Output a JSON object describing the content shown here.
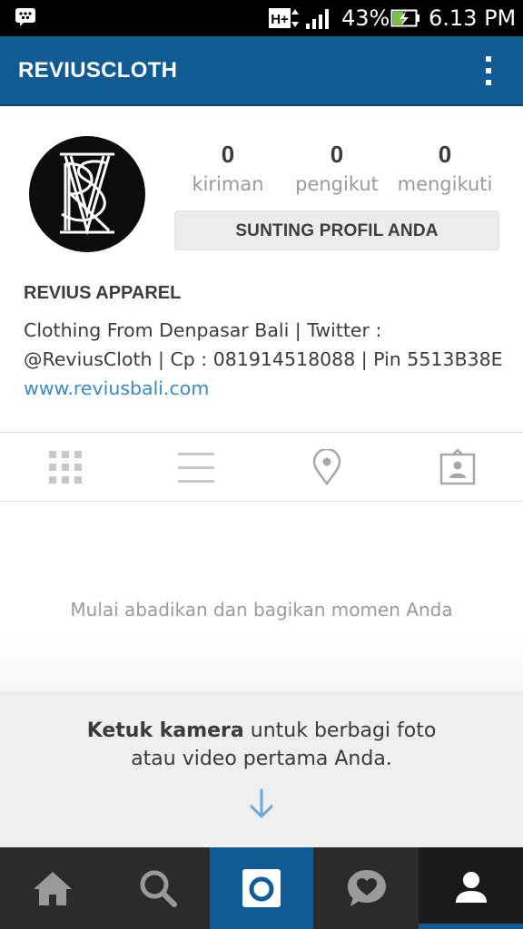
{
  "status_bar": {
    "network": "H+",
    "battery_percent": "43%",
    "time": "6.13 PM",
    "icons": [
      "bbm-icon",
      "hplus-data-icon",
      "signal-icon",
      "battery-charging-icon"
    ]
  },
  "action_bar": {
    "title": "REVIUSCLOTH",
    "menu_icon": "overflow-menu-icon"
  },
  "profile": {
    "avatar_icon": "revius-monogram-logo",
    "stats": [
      {
        "count": "0",
        "label": "kiriman"
      },
      {
        "count": "0",
        "label": "pengikut"
      },
      {
        "count": "0",
        "label": "mengikuti"
      }
    ],
    "edit_button": "SUNTING PROFIL ANDA",
    "full_name": "REVIUS APPAREL",
    "bio": "Clothing From Denpasar Bali  |  Twitter : @ReviusCloth | Cp : 081914518088 | Pin 5513B38E",
    "website": "www.reviusbali.com"
  },
  "view_tabs": [
    {
      "icon": "grid-icon"
    },
    {
      "icon": "list-icon"
    },
    {
      "icon": "map-pin-icon"
    },
    {
      "icon": "tagged-photo-icon"
    }
  ],
  "empty_state": {
    "message": "Mulai abadikan dan bagikan momen Anda",
    "hint_bold": "Ketuk kamera",
    "hint_rest_line1": " untuk berbagi foto",
    "hint_line2": "atau video pertama Anda.",
    "arrow_icon": "arrow-down-icon"
  },
  "bottom_nav": [
    {
      "icon": "home-icon"
    },
    {
      "icon": "search-icon"
    },
    {
      "icon": "camera-icon"
    },
    {
      "icon": "activity-heart-icon"
    },
    {
      "icon": "profile-icon"
    }
  ],
  "colors": {
    "brand_blue": "#115b95",
    "link_blue": "#3b8ac4",
    "nav_dark": "#2b2b2b"
  }
}
